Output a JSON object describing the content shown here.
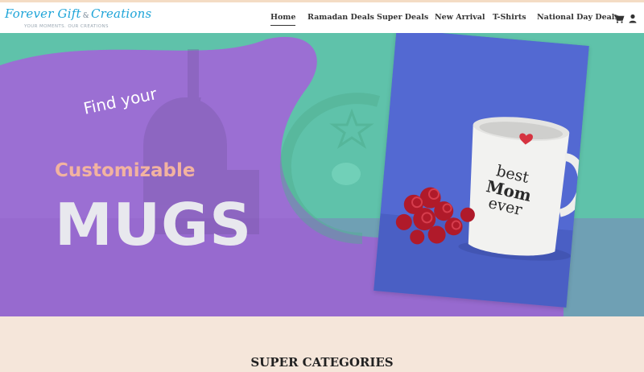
{
  "brand": {
    "name": "Forever Gift",
    "ampersand": "&",
    "name2": "Creations",
    "tagline": "YOUR MOMENTS. OUR CREATIONS"
  },
  "nav": {
    "items": [
      {
        "label": "Home",
        "active": true
      },
      {
        "label": "Ramadan Deals"
      },
      {
        "label": "Super Deals"
      },
      {
        "label": "New Arrival"
      },
      {
        "label": "T-Shirts"
      },
      {
        "label": "National Day Deals"
      }
    ],
    "cart_icon": "cart-icon",
    "user_icon": "user-icon"
  },
  "hero": {
    "line1": "Find your",
    "line2": "Customizable",
    "line3": "MUGS",
    "mug_line1": "best",
    "mug_line2": "Mom",
    "mug_line3": "ever",
    "colors": {
      "purple": "#9b6fd3",
      "teal": "#5fc2aa",
      "photo_bg": "#5369d2"
    }
  },
  "sections": {
    "super_categories_title": "SUPER CATEGORIES"
  },
  "colors": {
    "accent": "#1da4d8",
    "band": "#f5e6da"
  }
}
